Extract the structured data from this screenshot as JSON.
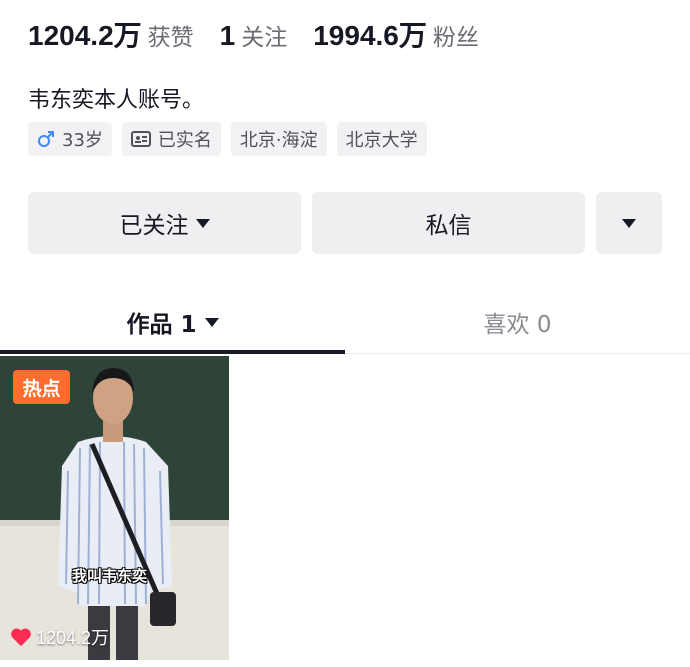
{
  "stats": [
    {
      "value": "1204.2万",
      "label": "获赞"
    },
    {
      "value": "1",
      "label": "关注"
    },
    {
      "value": "1994.6万",
      "label": "粉丝"
    }
  ],
  "bio": "韦东奕本人账号。",
  "tags": [
    {
      "icon": "male-gender-icon",
      "text": "33岁"
    },
    {
      "icon": "id-card-icon",
      "text": "已实名"
    },
    {
      "icon": "",
      "text": "北京·海淀"
    },
    {
      "icon": "",
      "text": "北京大学"
    }
  ],
  "buttons": {
    "follow_label": "已关注",
    "message_label": "私信",
    "more_icon": "caret-down-icon"
  },
  "tabs": {
    "works_label": "作品 1",
    "likes_label": "喜欢 0"
  },
  "video": {
    "badge": "热点",
    "caption": "我叫韦东奕",
    "likes": "1204.2万"
  },
  "colors": {
    "accent_badge": "#ff6d2e",
    "male_icon": "#3e8cf0",
    "heart": "#fe2c55",
    "button_bg": "#efeff1"
  }
}
